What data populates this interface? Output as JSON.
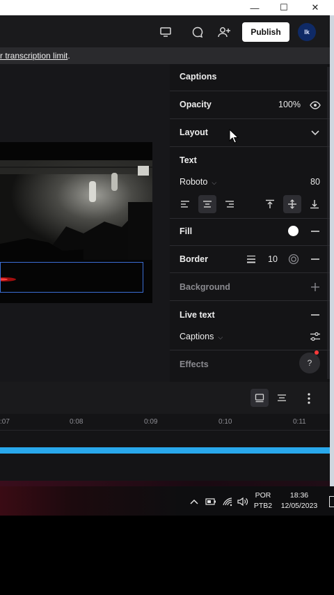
{
  "window": {
    "minimize_glyph": "—",
    "maximize_glyph": "☐",
    "close_glyph": "✕"
  },
  "header": {
    "publish_label": "Publish",
    "avatar_initials": "lk",
    "icons": [
      "present-icon",
      "comment-icon",
      "add-user-icon"
    ]
  },
  "notice": {
    "link_text": "r transcription limit",
    "trailing": "."
  },
  "panel": {
    "captions_title": "Captions",
    "opacity_label": "Opacity",
    "opacity_value": "100%",
    "layout_label": "Layout",
    "text_label": "Text",
    "font_name": "Roboto",
    "font_size": "80",
    "fill_label": "Fill",
    "fill_color": "#ffffff",
    "border_label": "Border",
    "border_value": "10",
    "background_label": "Background",
    "live_text_label": "Live text",
    "live_captions_label": "Captions",
    "effects_label": "Effects",
    "help_glyph": "?"
  },
  "timeline": {
    "ticks": [
      ":07",
      "0:08",
      "0:09",
      "0:10",
      "0:11"
    ],
    "track_color": "#29a8ec"
  },
  "taskbar": {
    "language": "POR",
    "layout": "PTB2",
    "time": "18:36",
    "date": "12/05/2023"
  }
}
